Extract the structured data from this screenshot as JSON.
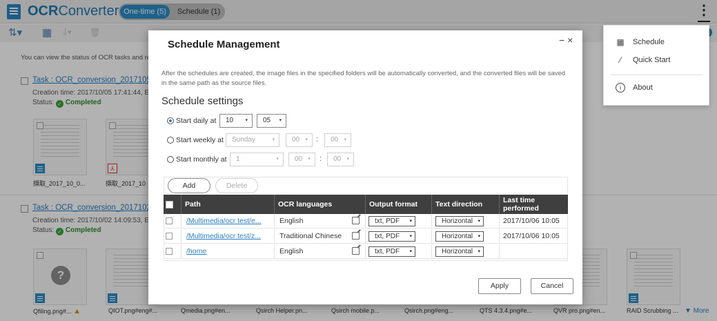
{
  "app": {
    "title_bold": "OCR",
    "title_rest": "Converter",
    "tabs": [
      {
        "label": "One-time (5)"
      },
      {
        "label": "Schedule (1)"
      }
    ],
    "kebab": "⋮"
  },
  "toolbar": {
    "sort": "⇅▾",
    "view": "▦",
    "download": "⤓▾",
    "delete": "🗑"
  },
  "intro": "You can view the status of OCR tasks and ren",
  "tasks": [
    {
      "title": "Task : OCR_conversion_2017105 (2",
      "created": "Creation time: 2017/10/05 17:41:44, E",
      "status_label": "Status:",
      "status": "Completed",
      "files": [
        "擷取_2017_10_0...",
        "擷取_2017_10"
      ]
    },
    {
      "title": "Task : OCR_conversion_2017102 (4",
      "created": "Creation time: 2017/10/02 14:09:53, E",
      "status_label": "Status:",
      "status": "Completed",
      "files": [
        "Qfiling.png#...",
        "QIOT.png#eng#...",
        "Qmedia.png#en...",
        "Qsirch Helper.pn...",
        "Qsirch mobile.p...",
        "Qsirch.png#eng...",
        "QTS 4.3.4.png#e...",
        "QVR pro.png#en...",
        "RAID Scrubbing ..."
      ],
      "more": "▼ More"
    }
  ],
  "menu": {
    "items": [
      {
        "label": "Schedule",
        "icon": "calendar-icon"
      },
      {
        "label": "Quick Start",
        "icon": "magic-wand-icon"
      },
      {
        "label": "About",
        "icon": "info-icon"
      }
    ]
  },
  "modal": {
    "title": "Schedule Management",
    "controls": "− ×",
    "description": "After the schedules are created, the image files in the specified folders will be automatically converted, and the converted files will be saved in the same path as the source files.",
    "settings_title": "Schedule settings",
    "daily": {
      "label": "Start daily at",
      "hour": "10",
      "minute": "05"
    },
    "weekly": {
      "label": "Start weekly at",
      "day": "Sunday",
      "hour": "00",
      "minute": "00"
    },
    "monthly": {
      "label": "Start monthly at",
      "day": "1",
      "hour": "00",
      "minute": "00"
    },
    "colon": ":",
    "add_label": "Add",
    "delete_label": "Delete",
    "columns": {
      "path": "Path",
      "languages": "OCR languages",
      "format": "Output format",
      "direction": "Text direction",
      "last_1": "Last time",
      "last_2": "performed"
    },
    "rows": [
      {
        "path": "/Multimedia/ocr test/e...",
        "language": "English",
        "format": "txt, PDF",
        "direction": "Horizontal",
        "last": "2017/10/06 10:05"
      },
      {
        "path": "/Multimedia/ocr test/z...",
        "language": "Traditional Chinese",
        "format": "txt, PDF",
        "direction": "Horizontal",
        "last": "2017/10/06 10:05"
      },
      {
        "path": "/home",
        "language": "English",
        "format": "txt, PDF",
        "direction": "Horizontal",
        "last": ""
      }
    ],
    "apply_label": "Apply",
    "cancel_label": "Cancel"
  },
  "caret": "▾",
  "check": "✓",
  "qmark": "?",
  "warn": "▲",
  "pdf_glyph": "⅄",
  "colors": {
    "accent": "#2b8cc6",
    "link": "#2b7ec1",
    "success": "#3aa53a",
    "header_dark": "#3f3f3f"
  }
}
